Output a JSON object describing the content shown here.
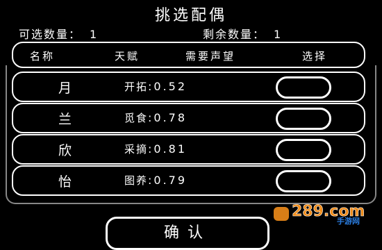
{
  "title": "挑选配偶",
  "counters": {
    "selectable_label": "可选数量：",
    "selectable_value": "1",
    "remaining_label": "剩余数量：",
    "remaining_value": "1"
  },
  "header": {
    "name": "名称",
    "talent": "天赋",
    "requirement": "需要声望",
    "pick": "选择"
  },
  "candidates": [
    {
      "name": "月",
      "talent_type": "开拓",
      "talent_value": ":0.52",
      "selected": false
    },
    {
      "name": "兰",
      "talent_type": "觅食",
      "talent_value": ":0.78",
      "selected": false
    },
    {
      "name": "欣",
      "talent_type": "采摘",
      "talent_value": ":0.81",
      "selected": false
    },
    {
      "name": "怡",
      "talent_type": "图养",
      "talent_value": ":0.79",
      "selected": false
    }
  ],
  "confirm_label": "确认",
  "watermark": {
    "brand": "289.com",
    "sub": "手游网",
    "colors": {
      "main": "#f08c1a",
      "sub": "#2b7de0"
    }
  }
}
